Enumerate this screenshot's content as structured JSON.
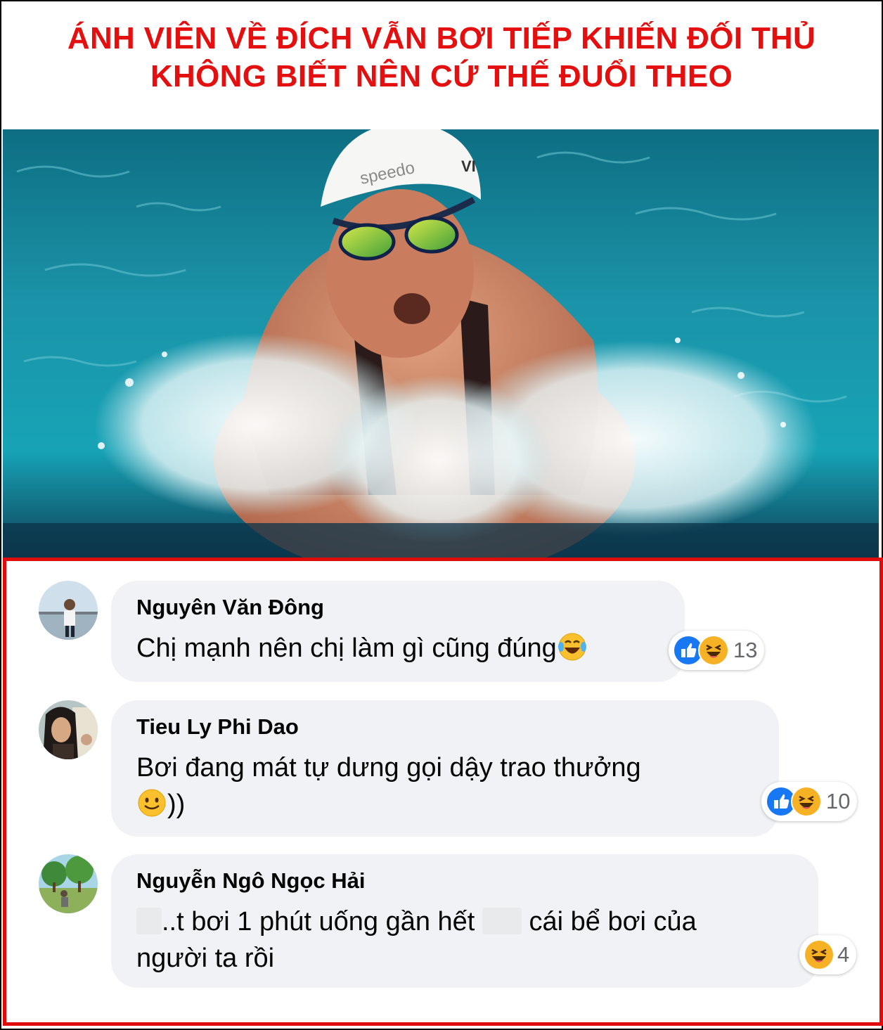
{
  "headline": {
    "line1": "ÁNH VIÊN VỀ ĐÍCH VẪN BƠI TIẾP KHIẾN ĐỐI THỦ",
    "line2": "KHÔNG BIẾT NÊN CỨ THẾ ĐUỔI THEO"
  },
  "photo": {
    "cap_text": "speedo",
    "cap_text2": "VI"
  },
  "comments": [
    {
      "name": "Nguyên Văn Đông",
      "text": "Chị mạnh nên chị làm gì cũng đúng",
      "emoji": "laughing-tears",
      "reactions": [
        "like",
        "haha"
      ],
      "count": "13"
    },
    {
      "name": "Tieu Ly Phi Dao",
      "text": "Bơi đang mát tự dưng gọi dậy trao thưởng",
      "text_line2": "))",
      "emoji": "smile",
      "reactions": [
        "like",
        "haha"
      ],
      "count": "10"
    },
    {
      "name": "Nguyễn Ngô Ngọc Hải",
      "text_part1": "..t bơi 1 phút uống gần hết",
      "text_part2": "cái bể bơi của",
      "text_line2": "người ta rồi",
      "reactions": [
        "haha"
      ],
      "count": "4"
    }
  ],
  "colors": {
    "headline": "#e41010",
    "frame": "#e00c0c",
    "bubble": "#f0f2f5",
    "like": "#1877f2",
    "haha": "#f7b125"
  }
}
